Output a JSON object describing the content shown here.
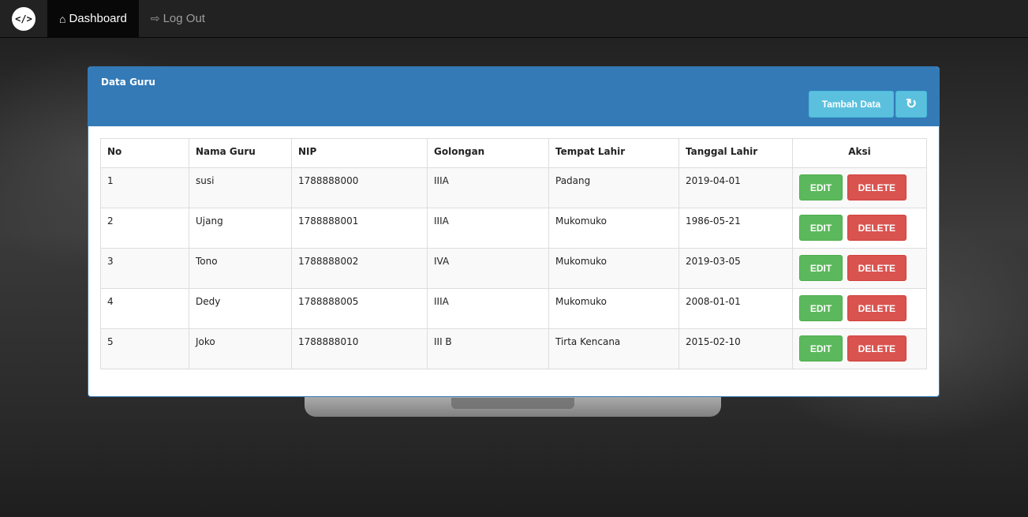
{
  "navbar": {
    "brand_icon": "code-icon",
    "brand_glyph": "</>",
    "items": [
      {
        "label": "Dashboard",
        "icon": "home-icon",
        "active": true
      },
      {
        "label": "Log Out",
        "icon": "logout-icon",
        "active": false
      }
    ]
  },
  "panel": {
    "title": "Data Guru",
    "add_button": "Tambah Data",
    "refresh_icon": "refresh-icon"
  },
  "table": {
    "headers": [
      "No",
      "Nama Guru",
      "NIP",
      "Golongan",
      "Tempat Lahir",
      "Tanggal Lahir",
      "Aksi"
    ],
    "rows": [
      {
        "no": "1",
        "nama": "susi",
        "nip": "1788888000",
        "golongan": "IIIA",
        "tempat": "Padang",
        "tanggal": "2019-04-01"
      },
      {
        "no": "2",
        "nama": "Ujang",
        "nip": "1788888001",
        "golongan": "IIIA",
        "tempat": "Mukomuko",
        "tanggal": "1986-05-21"
      },
      {
        "no": "3",
        "nama": "Tono",
        "nip": "1788888002",
        "golongan": "IVA",
        "tempat": "Mukomuko",
        "tanggal": "2019-03-05"
      },
      {
        "no": "4",
        "nama": "Dedy",
        "nip": "1788888005",
        "golongan": "IIIA",
        "tempat": "Mukomuko",
        "tanggal": "2008-01-01"
      },
      {
        "no": "5",
        "nama": "Joko",
        "nip": "1788888010",
        "golongan": "III B",
        "tempat": "Tirta Kencana",
        "tanggal": "2015-02-10"
      }
    ],
    "edit_label": "EDIT",
    "delete_label": "DELETE"
  },
  "colors": {
    "navbar": "#222222",
    "panel_primary": "#337ab7",
    "info": "#5bc0de",
    "success": "#5cb85c",
    "danger": "#d9534f"
  }
}
